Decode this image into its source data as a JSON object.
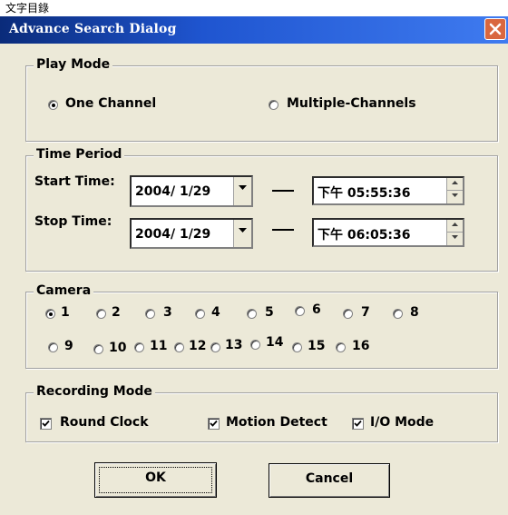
{
  "top_strip": {
    "fragment": "文字目錄"
  },
  "window": {
    "title": "Advance Search Dialog"
  },
  "play_mode": {
    "title": "Play Mode",
    "options": [
      "One Channel",
      "Multiple-Channels"
    ],
    "selected": 0
  },
  "time_period": {
    "title": "Time Period",
    "start_label": "Start Time:",
    "stop_label": "Stop Time:",
    "start_date": "2004/ 1/29",
    "start_time": "下午 05:55:36",
    "stop_date": "2004/ 1/29",
    "stop_time": "下午 06:05:36"
  },
  "camera": {
    "title": "Camera",
    "labels": [
      "1",
      "2",
      "3",
      "4",
      "5",
      "6",
      "7",
      "8",
      "9",
      "10",
      "11",
      "12",
      "13",
      "14",
      "15",
      "16"
    ],
    "selected": "1"
  },
  "recording_mode": {
    "title": "Recording Mode",
    "options": [
      "Round Clock",
      "Motion Detect",
      "I/O Mode"
    ],
    "checked": [
      true,
      true,
      true
    ]
  },
  "buttons": {
    "ok": "OK",
    "cancel": "Cancel"
  }
}
